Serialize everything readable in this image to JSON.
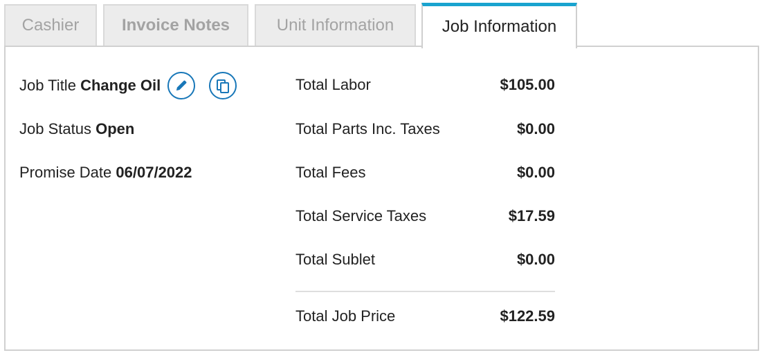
{
  "tabs": [
    {
      "label": "Cashier"
    },
    {
      "label": "Invoice Notes"
    },
    {
      "label": "Unit Information"
    },
    {
      "label": "Job Information"
    }
  ],
  "job": {
    "title_label": "Job Title",
    "title_value": "Change Oil",
    "status_label": "Job Status",
    "status_value": "Open",
    "promise_label": "Promise Date",
    "promise_value": "06/07/2022",
    "edit_icon": "pencil-icon",
    "copy_icon": "copy-icon"
  },
  "totals": [
    {
      "label": "Total Labor",
      "amount": "$105.00"
    },
    {
      "label": "Total Parts Inc. Taxes",
      "amount": "$0.00"
    },
    {
      "label": "Total Fees",
      "amount": "$0.00"
    },
    {
      "label": "Total Service Taxes",
      "amount": "$17.59"
    },
    {
      "label": "Total Sublet",
      "amount": "$0.00"
    }
  ],
  "grand_total": {
    "label": "Total Job Price",
    "amount": "$122.59"
  },
  "colors": {
    "accent": "#1aa3cf",
    "icon": "#1877b8",
    "inactive_tab_bg": "#ececec",
    "inactive_tab_text": "#a3a3a3"
  }
}
